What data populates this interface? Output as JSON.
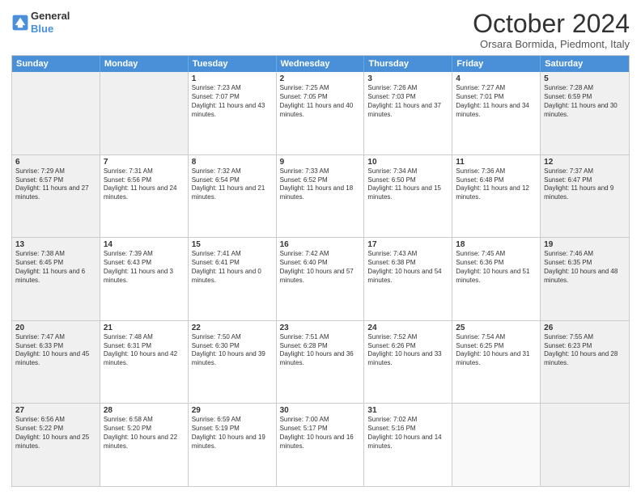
{
  "logo": {
    "line1": "General",
    "line2": "Blue"
  },
  "title": "October 2024",
  "location": "Orsara Bormida, Piedmont, Italy",
  "header_days": [
    "Sunday",
    "Monday",
    "Tuesday",
    "Wednesday",
    "Thursday",
    "Friday",
    "Saturday"
  ],
  "rows": [
    [
      {
        "day": "",
        "info": "",
        "shaded": true
      },
      {
        "day": "",
        "info": "",
        "shaded": true
      },
      {
        "day": "1",
        "info": "Sunrise: 7:23 AM\nSunset: 7:07 PM\nDaylight: 11 hours and 43 minutes.",
        "shaded": false
      },
      {
        "day": "2",
        "info": "Sunrise: 7:25 AM\nSunset: 7:05 PM\nDaylight: 11 hours and 40 minutes.",
        "shaded": false
      },
      {
        "day": "3",
        "info": "Sunrise: 7:26 AM\nSunset: 7:03 PM\nDaylight: 11 hours and 37 minutes.",
        "shaded": false
      },
      {
        "day": "4",
        "info": "Sunrise: 7:27 AM\nSunset: 7:01 PM\nDaylight: 11 hours and 34 minutes.",
        "shaded": false
      },
      {
        "day": "5",
        "info": "Sunrise: 7:28 AM\nSunset: 6:59 PM\nDaylight: 11 hours and 30 minutes.",
        "shaded": true
      }
    ],
    [
      {
        "day": "6",
        "info": "Sunrise: 7:29 AM\nSunset: 6:57 PM\nDaylight: 11 hours and 27 minutes.",
        "shaded": true
      },
      {
        "day": "7",
        "info": "Sunrise: 7:31 AM\nSunset: 6:56 PM\nDaylight: 11 hours and 24 minutes.",
        "shaded": false
      },
      {
        "day": "8",
        "info": "Sunrise: 7:32 AM\nSunset: 6:54 PM\nDaylight: 11 hours and 21 minutes.",
        "shaded": false
      },
      {
        "day": "9",
        "info": "Sunrise: 7:33 AM\nSunset: 6:52 PM\nDaylight: 11 hours and 18 minutes.",
        "shaded": false
      },
      {
        "day": "10",
        "info": "Sunrise: 7:34 AM\nSunset: 6:50 PM\nDaylight: 11 hours and 15 minutes.",
        "shaded": false
      },
      {
        "day": "11",
        "info": "Sunrise: 7:36 AM\nSunset: 6:48 PM\nDaylight: 11 hours and 12 minutes.",
        "shaded": false
      },
      {
        "day": "12",
        "info": "Sunrise: 7:37 AM\nSunset: 6:47 PM\nDaylight: 11 hours and 9 minutes.",
        "shaded": true
      }
    ],
    [
      {
        "day": "13",
        "info": "Sunrise: 7:38 AM\nSunset: 6:45 PM\nDaylight: 11 hours and 6 minutes.",
        "shaded": true
      },
      {
        "day": "14",
        "info": "Sunrise: 7:39 AM\nSunset: 6:43 PM\nDaylight: 11 hours and 3 minutes.",
        "shaded": false
      },
      {
        "day": "15",
        "info": "Sunrise: 7:41 AM\nSunset: 6:41 PM\nDaylight: 11 hours and 0 minutes.",
        "shaded": false
      },
      {
        "day": "16",
        "info": "Sunrise: 7:42 AM\nSunset: 6:40 PM\nDaylight: 10 hours and 57 minutes.",
        "shaded": false
      },
      {
        "day": "17",
        "info": "Sunrise: 7:43 AM\nSunset: 6:38 PM\nDaylight: 10 hours and 54 minutes.",
        "shaded": false
      },
      {
        "day": "18",
        "info": "Sunrise: 7:45 AM\nSunset: 6:36 PM\nDaylight: 10 hours and 51 minutes.",
        "shaded": false
      },
      {
        "day": "19",
        "info": "Sunrise: 7:46 AM\nSunset: 6:35 PM\nDaylight: 10 hours and 48 minutes.",
        "shaded": true
      }
    ],
    [
      {
        "day": "20",
        "info": "Sunrise: 7:47 AM\nSunset: 6:33 PM\nDaylight: 10 hours and 45 minutes.",
        "shaded": true
      },
      {
        "day": "21",
        "info": "Sunrise: 7:48 AM\nSunset: 6:31 PM\nDaylight: 10 hours and 42 minutes.",
        "shaded": false
      },
      {
        "day": "22",
        "info": "Sunrise: 7:50 AM\nSunset: 6:30 PM\nDaylight: 10 hours and 39 minutes.",
        "shaded": false
      },
      {
        "day": "23",
        "info": "Sunrise: 7:51 AM\nSunset: 6:28 PM\nDaylight: 10 hours and 36 minutes.",
        "shaded": false
      },
      {
        "day": "24",
        "info": "Sunrise: 7:52 AM\nSunset: 6:26 PM\nDaylight: 10 hours and 33 minutes.",
        "shaded": false
      },
      {
        "day": "25",
        "info": "Sunrise: 7:54 AM\nSunset: 6:25 PM\nDaylight: 10 hours and 31 minutes.",
        "shaded": false
      },
      {
        "day": "26",
        "info": "Sunrise: 7:55 AM\nSunset: 6:23 PM\nDaylight: 10 hours and 28 minutes.",
        "shaded": true
      }
    ],
    [
      {
        "day": "27",
        "info": "Sunrise: 6:56 AM\nSunset: 5:22 PM\nDaylight: 10 hours and 25 minutes.",
        "shaded": true
      },
      {
        "day": "28",
        "info": "Sunrise: 6:58 AM\nSunset: 5:20 PM\nDaylight: 10 hours and 22 minutes.",
        "shaded": false
      },
      {
        "day": "29",
        "info": "Sunrise: 6:59 AM\nSunset: 5:19 PM\nDaylight: 10 hours and 19 minutes.",
        "shaded": false
      },
      {
        "day": "30",
        "info": "Sunrise: 7:00 AM\nSunset: 5:17 PM\nDaylight: 10 hours and 16 minutes.",
        "shaded": false
      },
      {
        "day": "31",
        "info": "Sunrise: 7:02 AM\nSunset: 5:16 PM\nDaylight: 10 hours and 14 minutes.",
        "shaded": false
      },
      {
        "day": "",
        "info": "",
        "shaded": false
      },
      {
        "day": "",
        "info": "",
        "shaded": true
      }
    ]
  ]
}
